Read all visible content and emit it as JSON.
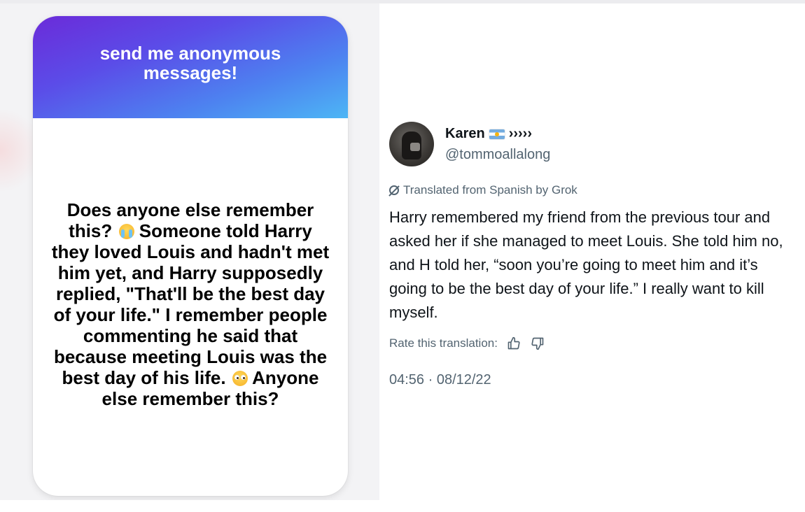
{
  "card": {
    "header_title": "send me anonymous messages!",
    "message_parts": [
      "Does anyone else remember this?",
      "Someone told Harry they loved Louis and hadn't met him yet, and Harry supposedly replied, \"That'll be the best day of your life.\" I remember people commenting he said that because meeting Louis was the best day of his life.",
      "Anyone else remember this?"
    ],
    "emoji_1": "loudly-crying-face",
    "emoji_2": "pleading-face"
  },
  "tweet": {
    "display_name": "Karen",
    "name_suffix": "›››››",
    "handle": "@tommoallalong",
    "translated_label": "Translated from Spanish by Grok",
    "text": "Harry remembered my friend from the previous tour and asked her if she managed to meet Louis. She told him no, and H told her, “soon you’re going to meet him and it’s going to be the best day of your life.” I really want to kill myself.",
    "rate_label": "Rate this translation:",
    "timestamp": "04:56 · 08/12/22"
  },
  "colors": {
    "header_gradient_start": "#6b2bd9",
    "header_gradient_end": "#4db6f5",
    "secondary_text": "#536471",
    "primary_text": "#0f1419"
  }
}
